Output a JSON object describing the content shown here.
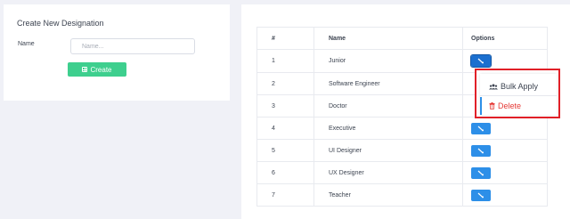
{
  "create_form": {
    "title": "Create New Designation",
    "name_label": "Name",
    "name_placeholder": "Name...",
    "name_value": "",
    "create_label": "Create",
    "create_color": "#3ecf8e"
  },
  "table": {
    "headers": [
      "#",
      "Name",
      "Options"
    ],
    "rows": [
      {
        "num": "1",
        "name": "Junior"
      },
      {
        "num": "2",
        "name": "Software Engineer"
      },
      {
        "num": "3",
        "name": "Doctor"
      },
      {
        "num": "4",
        "name": "Executive"
      },
      {
        "num": "5",
        "name": "UI Designer"
      },
      {
        "num": "6",
        "name": "UX Designer"
      },
      {
        "num": "7",
        "name": "Teacher"
      }
    ],
    "option_button_icon": "wrench-icon",
    "option_button_color": "#2d8fe8"
  },
  "options_menu": {
    "items": [
      {
        "label": "Bulk Apply",
        "icon": "users-icon",
        "color": "#3d4451"
      },
      {
        "label": "Delete",
        "icon": "trash-icon",
        "color": "#e53935"
      }
    ],
    "highlight_color": "#e12028"
  }
}
